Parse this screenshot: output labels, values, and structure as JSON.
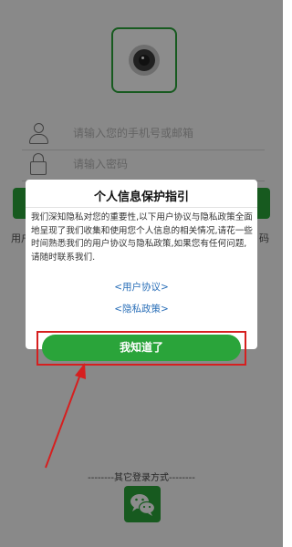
{
  "login": {
    "phone_placeholder": "请输入您的手机号或邮箱",
    "password_placeholder": "请输入密码",
    "agreement_left": "用户",
    "agreement_right": "码"
  },
  "dialog": {
    "title": "个人信息保护指引",
    "body": "我们深知隐私对您的重要性,以下用户协议与隐私政策全面地呈现了我们收集和使用您个人信息的相关情况,请花一些时间熟悉我们的用户协议与隐私政策,如果您有任何问题,请随时联系我们.",
    "user_agreement_link": "<用户协议>",
    "privacy_policy_link": "<隐私政策>",
    "confirm_button": "我知道了"
  },
  "footer": {
    "other_login_label": "--------其它登录方式--------"
  },
  "colors": {
    "brand_green": "#2aa43a",
    "link_blue": "#2a6fb8",
    "annotation_red": "#d61f1f"
  }
}
